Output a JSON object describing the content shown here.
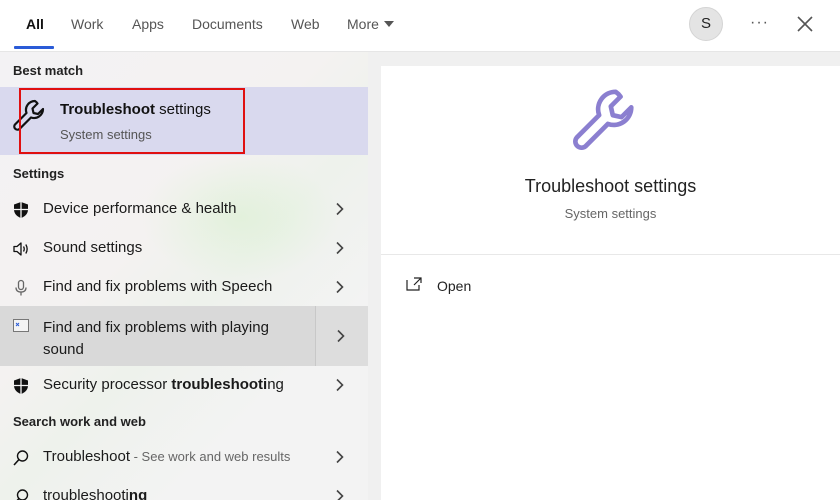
{
  "tabs": [
    {
      "label": "All",
      "active": true
    },
    {
      "label": "Work"
    },
    {
      "label": "Apps"
    },
    {
      "label": "Documents"
    },
    {
      "label": "Web"
    },
    {
      "label": "More"
    }
  ],
  "user": {
    "initial": "S"
  },
  "header": {
    "more_options": "···"
  },
  "sections": {
    "best_match": "Best match",
    "settings": "Settings",
    "search_web": "Search work and web"
  },
  "best_match": {
    "title_bold": "Troubleshoot",
    "title_rest": " settings",
    "subtitle": "System settings"
  },
  "settings_items": [
    {
      "label": "Device performance & health",
      "icon": "shield-icon"
    },
    {
      "label": "Sound settings",
      "icon": "speaker-icon"
    },
    {
      "label": "Find and fix problems with Speech",
      "icon": "microphone-icon"
    },
    {
      "label": "Find and fix problems with playing sound",
      "icon": "troubleshooter-app-icon",
      "selected": true
    },
    {
      "label_pre": "Security processor ",
      "label_bold": "troubleshooti",
      "label_post": "ng",
      "icon": "shield-icon"
    }
  ],
  "web_items": [
    {
      "label": "Troubleshoot",
      "sub": " - See work and web results",
      "icon": "search-icon"
    },
    {
      "label_pre": "troubleshooti",
      "label_bold": "ng",
      "icon": "search-icon"
    }
  ],
  "preview": {
    "title": "Troubleshoot settings",
    "subtitle": "System settings",
    "open_label": "Open"
  },
  "colors": {
    "accent": "#2a5bd7",
    "highlight": "#e01010",
    "best_match_bg": "#d9d9ee",
    "wrench": "#8b7fd0"
  }
}
